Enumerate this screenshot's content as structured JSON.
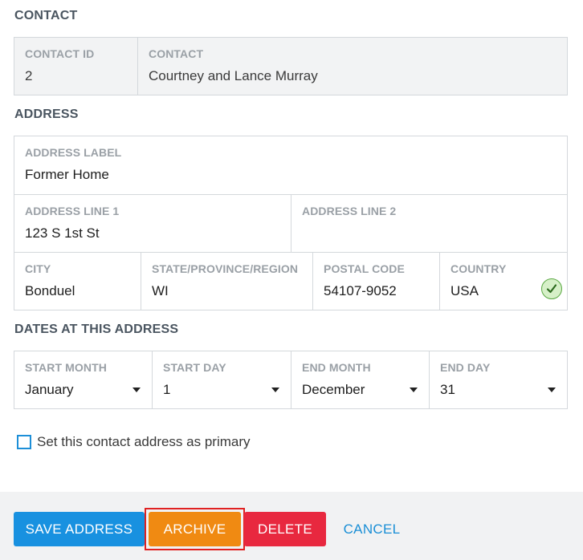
{
  "contact_section": {
    "title": "CONTACT",
    "contact_id_label": "CONTACT ID",
    "contact_id_value": "2",
    "contact_label": "CONTACT",
    "contact_value": "Courtney and Lance Murray"
  },
  "address_section": {
    "title": "ADDRESS",
    "address_label_label": "ADDRESS LABEL",
    "address_label_value": "Former Home",
    "line1_label": "ADDRESS LINE 1",
    "line1_value": "123 S 1st St",
    "line2_label": "ADDRESS LINE 2",
    "line2_value": "",
    "city_label": "CITY",
    "city_value": "Bonduel",
    "state_label": "STATE/PROVINCE/REGION",
    "state_value": "WI",
    "postal_label": "POSTAL CODE",
    "postal_value": "54107-9052",
    "country_label": "COUNTRY",
    "country_value": "USA",
    "country_valid_icon": "check-circle-icon"
  },
  "dates_section": {
    "title": "DATES AT THIS ADDRESS",
    "start_month_label": "START MONTH",
    "start_month_value": "January",
    "start_day_label": "START DAY",
    "start_day_value": "1",
    "end_month_label": "END MONTH",
    "end_month_value": "December",
    "end_day_label": "END DAY",
    "end_day_value": "31"
  },
  "primary": {
    "label": "Set this contact address as primary",
    "checked": false
  },
  "actions": {
    "save_label": "SAVE ADDRESS",
    "archive_label": "ARCHIVE",
    "delete_label": "DELETE",
    "cancel_label": "CANCEL"
  },
  "colors": {
    "save": "#1891e0",
    "archive": "#f08a12",
    "delete": "#e8283f",
    "cancel": "#1a8fd6",
    "highlight": "#e02121"
  }
}
